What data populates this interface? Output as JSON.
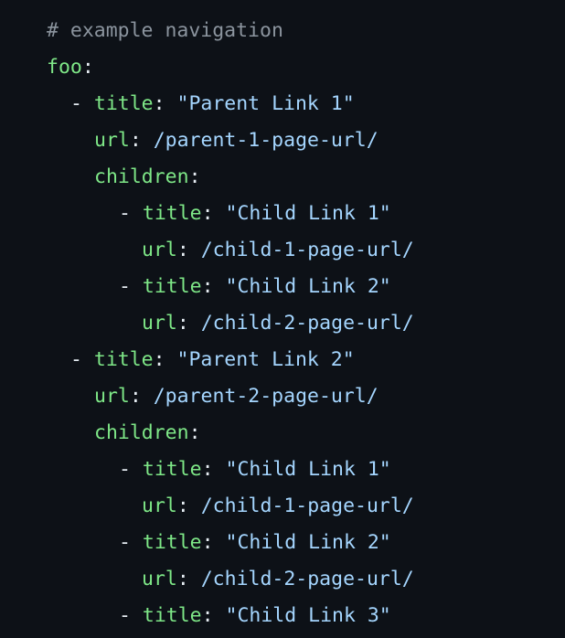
{
  "code": {
    "comment": "# example navigation",
    "root_key": "foo",
    "colon": ":",
    "dash": "- ",
    "sep": ": ",
    "key_title": "title",
    "key_url": "url",
    "key_children": "children",
    "parents": [
      {
        "title": "\"Parent Link 1\"",
        "url": "/parent-1-page-url/",
        "children": [
          {
            "title": "\"Child Link 1\"",
            "url": "/child-1-page-url/"
          },
          {
            "title": "\"Child Link 2\"",
            "url": "/child-2-page-url/"
          }
        ]
      },
      {
        "title": "\"Parent Link 2\"",
        "url": "/parent-2-page-url/",
        "children": [
          {
            "title": "\"Child Link 1\"",
            "url": "/child-1-page-url/"
          },
          {
            "title": "\"Child Link 2\"",
            "url": "/child-2-page-url/"
          },
          {
            "title": "\"Child Link 3\""
          }
        ]
      }
    ]
  },
  "colors": {
    "background": "#0d1117",
    "comment": "#8b949e",
    "key": "#7ee787",
    "string": "#a5d6ff",
    "text": "#e6edf3"
  }
}
